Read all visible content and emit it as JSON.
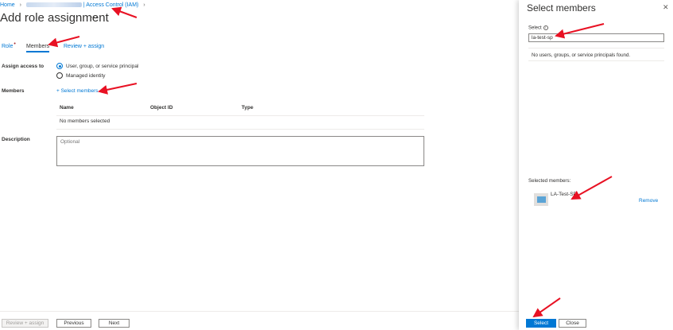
{
  "breadcrumb": {
    "home": "Home",
    "current": "| Access Control (IAM)"
  },
  "page": {
    "title": "Add role assignment",
    "more": "···"
  },
  "tabs": [
    {
      "label": "Role",
      "required": "•"
    },
    {
      "label": "Members"
    },
    {
      "label": "Review + assign"
    }
  ],
  "form": {
    "assign_access_label": "Assign access to",
    "options": [
      "User, group, or service principal",
      "Managed identity"
    ],
    "members_label": "Members",
    "select_members_link": "+ Select members",
    "table_headers": [
      "Name",
      "Object ID",
      "Type"
    ],
    "table_empty": "No members selected",
    "description_label": "Description",
    "description_placeholder": "Optional"
  },
  "footer": {
    "review_assign": "Review + assign",
    "previous": "Previous",
    "next": "Next"
  },
  "panel": {
    "title": "Select members",
    "close": "✕",
    "select_label": "Select",
    "info": "i",
    "search_value": "la-test-sp",
    "no_results": "No users, groups, or service principals found.",
    "selected_label": "Selected members:",
    "selected_member": "LA-Test-SP",
    "remove": "Remove",
    "select_button": "Select",
    "close_button": "Close"
  },
  "colors": {
    "accent": "#0078d4",
    "annotation": "#e81123"
  }
}
